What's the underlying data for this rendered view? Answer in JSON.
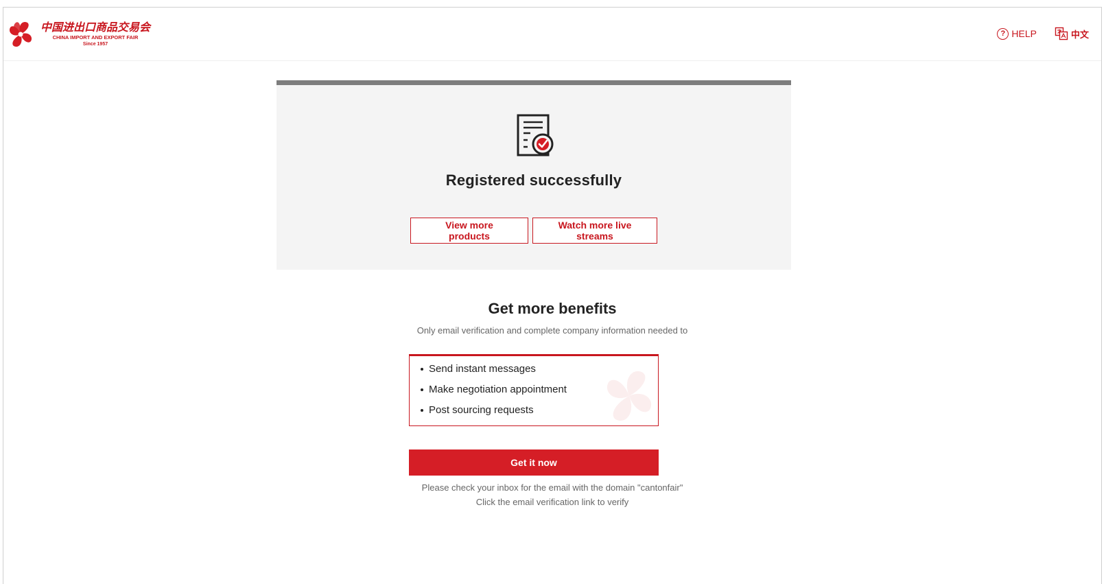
{
  "header": {
    "logo": {
      "cn_name": "中国进出口商品交易会",
      "en_name": "CHINA IMPORT AND EXPORT FAIR",
      "since": "Since 1957",
      "icon": "canton-fair-flower-logo"
    },
    "help_label": "HELP",
    "help_icon": "question-circle-icon",
    "language_label": "中文",
    "language_icon": "translate-icon"
  },
  "success": {
    "icon": "document-check-icon",
    "title": "Registered successfully",
    "view_products_label": "View more products",
    "watch_streams_label": "Watch more live streams"
  },
  "benefits": {
    "title": "Get more benefits",
    "subtitle": "Only email verification and complete company information needed to",
    "items": [
      "Send instant messages",
      "Make negotiation appointment",
      "Post sourcing requests"
    ],
    "cta_label": "Get it now",
    "note_line1": "Please check your inbox for the email with the domain \"cantonfair\"",
    "note_line2": "Click the email verification link to verify"
  },
  "colors": {
    "brand_red": "#d51e26",
    "card_bg": "#f4f4f4",
    "card_top_bar": "#7d7d7d"
  }
}
